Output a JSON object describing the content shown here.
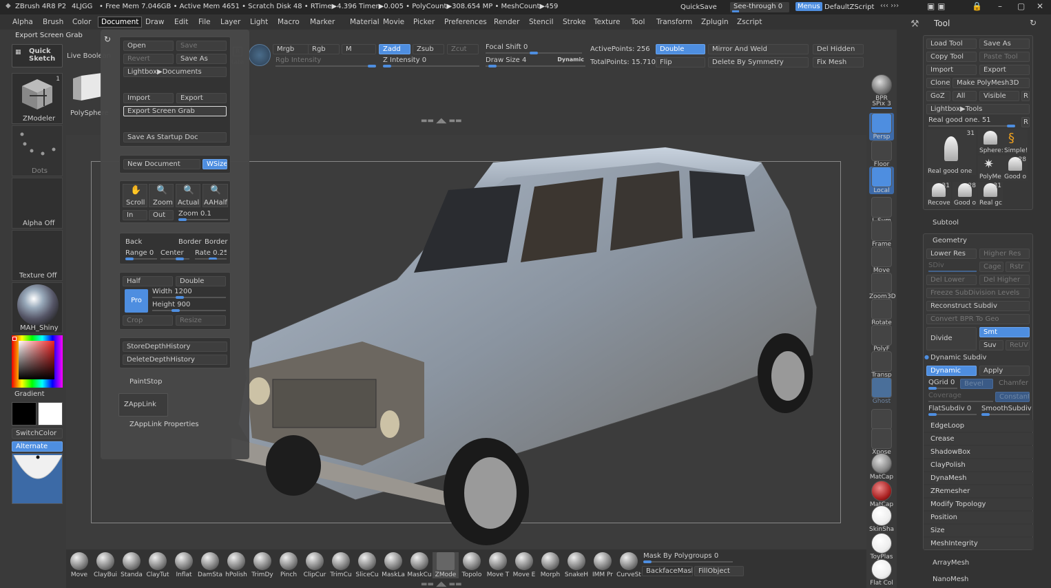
{
  "titlebar": {
    "app": "ZBrush 4R8 P2",
    "build": "4LJGG",
    "stats": "• Free Mem 7.046GB • Active Mem 4651 • Scratch Disk 48 • RTime▶4.396 Timer▶0.005 • PolyCount▶308.654 MP • MeshCount▶459",
    "quicksave": "QuickSave",
    "seethrough": "See-through  0",
    "menus": "Menus",
    "script": "DefaultZScript"
  },
  "menubar": [
    "Alpha",
    "Brush",
    "Color",
    "Document",
    "Draw",
    "Edit",
    "File",
    "Layer",
    "Light",
    "Macro",
    "Marker",
    "Material",
    "Movie",
    "Picker",
    "Preferences",
    "Render",
    "Stencil",
    "Stroke",
    "Texture",
    "Tool",
    "Transform",
    "Zplugin",
    "Zscript"
  ],
  "active_menu": "Document",
  "hint": "Export Screen Grab",
  "left": {
    "quicksketch": "Quick Sketch",
    "liveboolean": "Live Boolean",
    "zmodeler": "ZModeler",
    "zmodeler_num": "1",
    "dots": "Dots",
    "alpha": "Alpha Off",
    "texture": "Texture Off",
    "material": "MAH_Shiny",
    "gradient": "Gradient",
    "switchcolor": "SwitchColor",
    "alternate": "Alternate",
    "polysphere": "PolySphere"
  },
  "toptools": {
    "mrgb": "Mrgb",
    "rgb": "Rgb",
    "m": "M",
    "zadd": "Zadd",
    "zsub": "Zsub",
    "zcut": "Zcut",
    "rgbintensity": "Rgb Intensity",
    "zintensity": "Z Intensity 0",
    "focal": "Focal Shift 0",
    "drawsize": "Draw Size 4",
    "dynamic": "Dynamic",
    "activepoints": "ActivePoints: 256",
    "totalpoints": "TotalPoints: 15.710 Mil",
    "double": "Double",
    "flip": "Flip",
    "mirrorweld": "Mirror And Weld",
    "deletesym": "Delete By Symmetry",
    "delhidden": "Del Hidden",
    "fixmesh": "Fix Mesh",
    "rotate_partial": "tate"
  },
  "doc": {
    "open": "Open",
    "save": "Save",
    "revert": "Revert",
    "saveas": "Save As",
    "lightbox": "Lightbox▶Documents",
    "import": "Import",
    "export": "Export",
    "exportgrab": "Export Screen Grab",
    "startup": "Save As Startup Doc",
    "newdoc": "New Document",
    "wsize": "WSize",
    "scroll": "Scroll",
    "zoom": "Zoom",
    "actual": "Actual",
    "aahalf": "AAHalf",
    "in": "In",
    "out": "Out",
    "zoomval": "Zoom 0.1",
    "back": "Back",
    "border1": "Border",
    "border2": "Border",
    "range": "Range 0",
    "center": "Center",
    "rate": "Rate 0.25",
    "half": "Half",
    "double": "Double",
    "pro": "Pro",
    "width": "Width 1200",
    "height": "Height 900",
    "crop": "Crop",
    "resize": "Resize",
    "storedepth": "StoreDepthHistory",
    "deletedepth": "DeleteDepthHistory",
    "paintstop": "PaintStop",
    "zapplink": "ZAppLink",
    "zapplinkprops": "ZAppLink Properties"
  },
  "shelf": {
    "labels": [
      "Move",
      "ClayBui",
      "Standa",
      "ClayTut",
      "Inflat",
      "DamSta",
      "hPolish",
      "TrimDy",
      "Pinch",
      "ClipCur",
      "TrimCu",
      "SliceCu",
      "MaskLa",
      "MaskCu",
      "ZMode",
      "Topolo",
      "Move T",
      "Move E",
      "Morph",
      "SnakeH",
      "IMM Pr",
      "CurveSt"
    ],
    "maskpoly": "Mask By Polygroups 0",
    "backface": "BackfaceMask",
    "fillobj": "FillObject"
  },
  "rightstrip": [
    "BPR",
    "SPix 3",
    "Persp",
    "Floor",
    "Local",
    "L.Sym",
    "Frame",
    "Move",
    "Zoom3D",
    "Rotate",
    "PolyF",
    "Transp",
    "Ghost",
    "Solo",
    "Xpose",
    "MatCap",
    "MatCap",
    "SkinSha",
    "ToyPlas",
    "Flat Col"
  ],
  "toolpanel": {
    "title": "Tool",
    "load": "Load Tool",
    "saveas": "Save As",
    "copy": "Copy Tool",
    "paste": "Paste Tool",
    "import": "Import",
    "export": "Export",
    "clone": "Clone",
    "makepoly": "Make PolyMesh3D",
    "goz": "GoZ",
    "all": "All",
    "visible": "Visible",
    "r": "R",
    "lightbox": "Lightbox▶Tools",
    "realgood": "Real good one. 51",
    "r2": "R",
    "thumbs": [
      {
        "label": "Real good one",
        "num": "31"
      },
      {
        "label": "Sphere:",
        "num": ""
      },
      {
        "label": "Simple!",
        "num": ""
      },
      {
        "label": "PolyMe",
        "num": ""
      },
      {
        "label": "Good o",
        "num": "28"
      },
      {
        "label": "Recove",
        "num": "31"
      },
      {
        "label": "Good o",
        "num": "28"
      },
      {
        "label": "Real gc",
        "num": "31"
      }
    ],
    "subtool": "Subtool",
    "geometry": "Geometry",
    "lowerres": "Lower Res",
    "higherres": "Higher Res",
    "sdiv": "SDiv",
    "cage": "Cage",
    "rstr": "Rstr",
    "dellower": "Del Lower",
    "delhigher": "Del Higher",
    "freeze": "Freeze SubDivision Levels",
    "reconstruct": "Reconstruct Subdiv",
    "convertbpr": "Convert BPR To Geo",
    "divide": "Divide",
    "smt": "Smt",
    "suv": "Suv",
    "reuv": "ReUV",
    "dynsubdiv": "Dynamic Subdiv",
    "dynamic": "Dynamic",
    "apply": "Apply",
    "qgrid": "QGrid 0",
    "bevel": "Bevel",
    "chamfer": "Chamfer",
    "coverage": "Coverage",
    "constant": "Constant",
    "flatsub": "FlatSubdiv 0",
    "smoothsub": "SmoothSubdiv",
    "items": [
      "EdgeLoop",
      "Crease",
      "ShadowBox",
      "ClayPolish",
      "DynaMesh",
      "ZRemesher",
      "Modify Topology",
      "Position",
      "Size",
      "MeshIntegrity"
    ],
    "arraymesh": "ArrayMesh",
    "nanomesh": "NanoMesh"
  },
  "colors": {
    "accent": "#4e8ee0",
    "bg": "#3a3a3a",
    "panel": "#2d2d2d"
  }
}
